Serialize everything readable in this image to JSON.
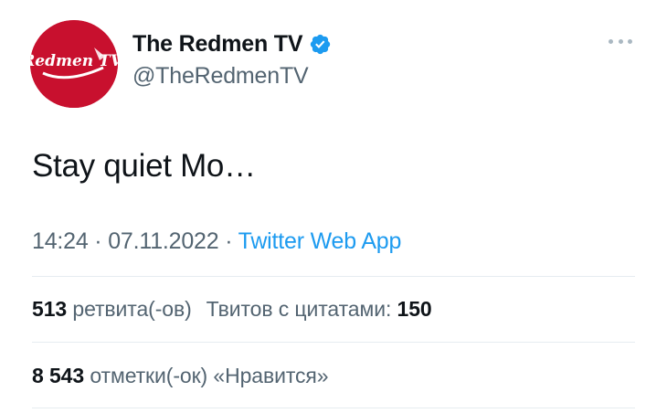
{
  "author": {
    "display_name": "The Redmen TV",
    "handle": "@TheRedmenTV",
    "avatar_text": "Redmen TV",
    "verified": true,
    "avatar_color": "#c8102e",
    "verified_color": "#1d9bf0"
  },
  "more_icon": "ellipsis-icon",
  "tweet": {
    "text": "Stay quiet Mo…"
  },
  "meta": {
    "time": "14:24",
    "separator": " · ",
    "date": "07.11.2022",
    "source": "Twitter Web App"
  },
  "stats": {
    "retweets_count": "513",
    "retweets_label": "ретвита(-ов)",
    "quotes_label": "Твитов с цитатами:",
    "quotes_count": "150",
    "likes_count": "8 543",
    "likes_label": "отметки(-ок) «Нравится»"
  },
  "colors": {
    "link": "#1d9bf0",
    "secondary_text": "#536471",
    "primary_text": "#0f1419",
    "divider": "#e6ecf0"
  }
}
